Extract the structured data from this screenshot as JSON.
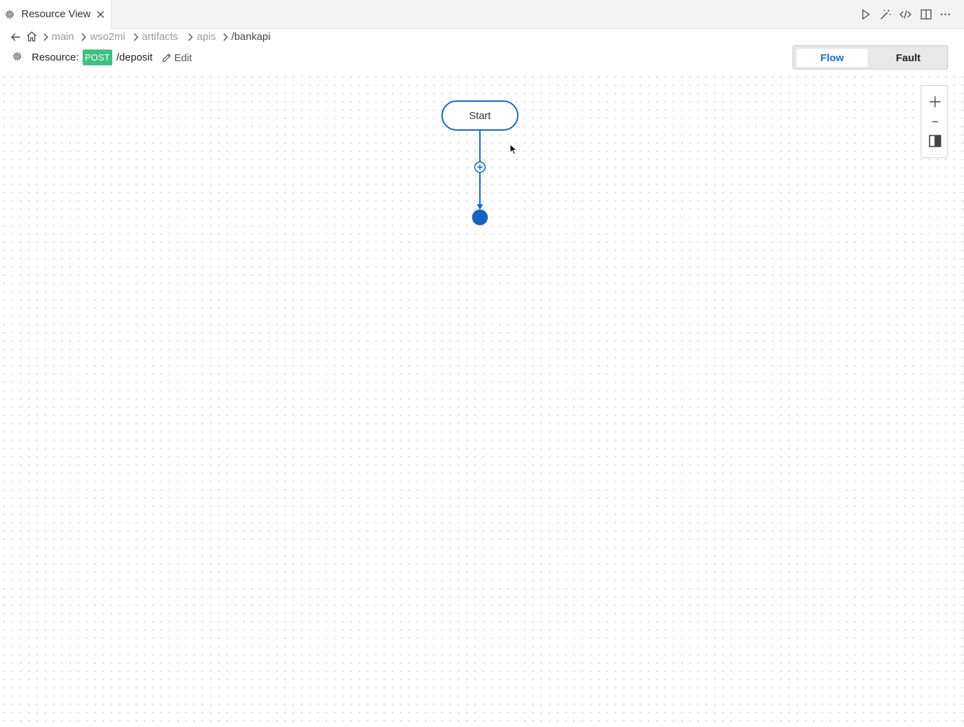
{
  "tab": {
    "title": "Resource View",
    "icon": "gear-icon",
    "close_icon": "close-icon"
  },
  "toolbar_icons": [
    "run-icon",
    "magic-wand-icon",
    "code-icon",
    "split-editor-icon",
    "more-icon"
  ],
  "breadcrumb": {
    "back_icon": "arrow-left-icon",
    "home_icon": "home-icon",
    "items": [
      "main",
      "wso2mi",
      "artifacts",
      "apis",
      "/bankapi"
    ]
  },
  "resource": {
    "label": "Resource:",
    "method": "POST",
    "path": "/deposit",
    "edit_label": "Edit",
    "method_color": "#3fbf80"
  },
  "view_toggle": {
    "flow_label": "Flow",
    "fault_label": "Fault",
    "active": "Flow"
  },
  "diagram": {
    "start_label": "Start",
    "accent_color": "#1565c0"
  },
  "zoom": {
    "zoom_in_icon": "plus-icon",
    "zoom_out_icon": "minus-icon",
    "fit_icon": "fit-view-icon"
  }
}
